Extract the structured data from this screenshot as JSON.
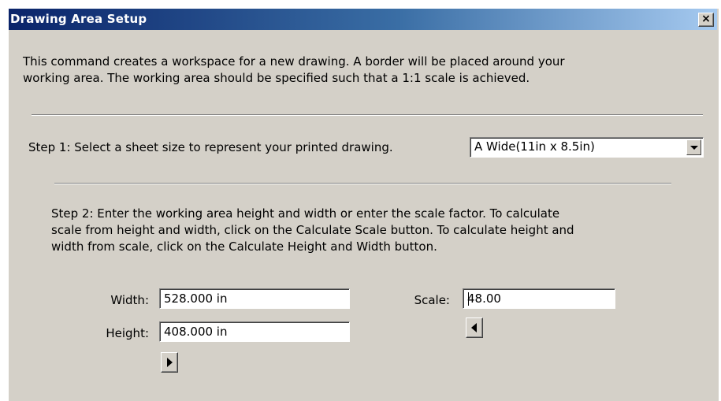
{
  "window": {
    "title": "Drawing Area Setup",
    "close_symbol": "×"
  },
  "intro": {
    "line1": "This command creates a workspace for a new drawing.  A border will be placed around your",
    "line2": "working area.  The working area should be specified such that a 1:1 scale is achieved."
  },
  "step1": {
    "label": "Step 1: Select a sheet size to represent your printed drawing.",
    "sheet_size": "A Wide(11in x 8.5in)"
  },
  "step2": {
    "line1": "Step 2: Enter the working area height and width or enter the scale factor.  To calculate",
    "line2": "scale from height and width, click on the Calculate Scale button.  To calculate height and",
    "line3": "width from scale, click on the Calculate Height and Width button."
  },
  "fields": {
    "width_label": "Width:",
    "width_value": "528.000 in",
    "height_label": "Height:",
    "height_value": "408.000 in",
    "scale_label": "Scale:",
    "scale_value": "48.00"
  },
  "icons": {
    "close": "close-icon",
    "dropdown": "chevron-down-icon",
    "calculate_scale": "triangle-right-icon",
    "calculate_height_width": "triangle-left-icon"
  },
  "colors": {
    "title_start": "#0a246a",
    "title_end": "#a6caf0",
    "dialog_bg": "#d4d0c8"
  }
}
